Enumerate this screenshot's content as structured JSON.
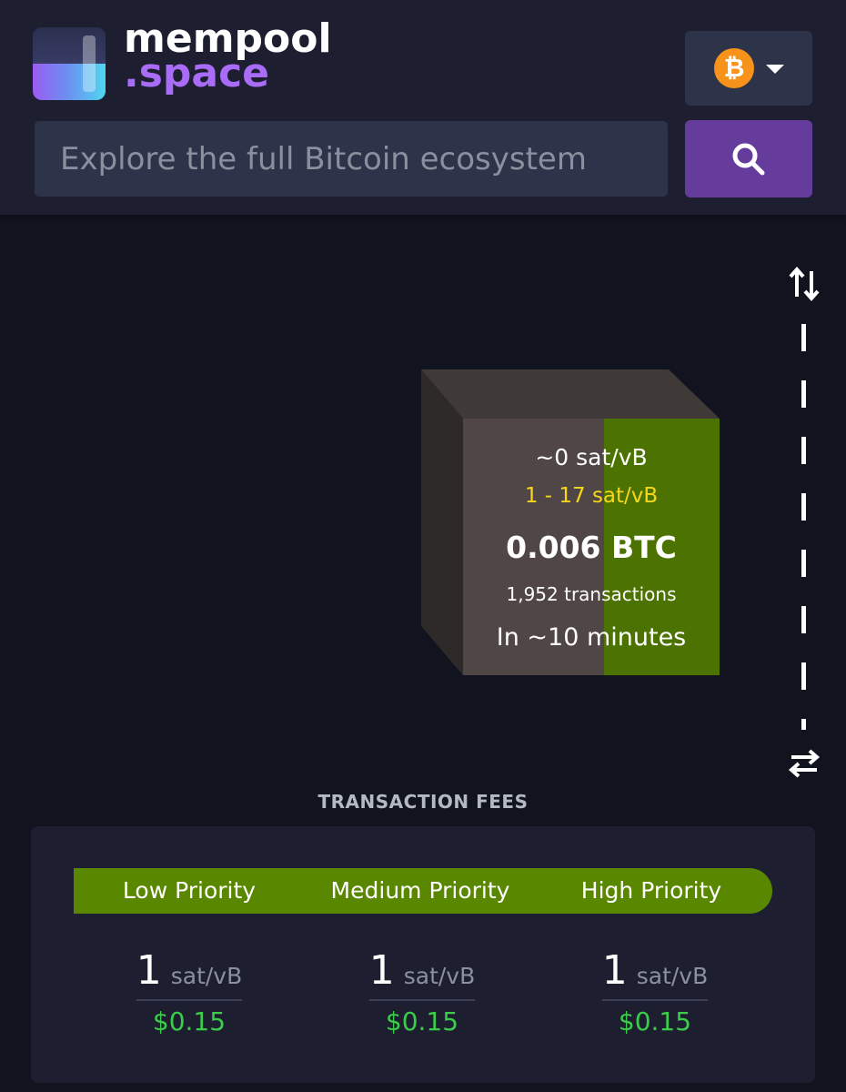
{
  "header": {
    "logo": {
      "line1": "mempool",
      "line2": ".space"
    },
    "network": {
      "icon": "bitcoin-icon",
      "symbol": "₿",
      "caret": "chevron-down-icon"
    },
    "search": {
      "placeholder": "Explore the full Bitcoin ecosystem",
      "value": "",
      "button_icon": "search-icon"
    }
  },
  "mempool_block": {
    "median_fee": "~0 sat/vB",
    "fee_range": "1 - 17 sat/vB",
    "total": "0.006 BTC",
    "transactions": "1,952 transactions",
    "eta": "In ~10 minutes",
    "fill_fraction": 0.45
  },
  "controls": {
    "toggle_layout_icon": "arrows-up-down-icon",
    "swap_icon": "arrows-left-right-icon"
  },
  "fees": {
    "title": "TRANSACTION FEES",
    "columns": [
      {
        "label": "Low Priority",
        "rate": "1",
        "unit": "sat/vB",
        "usd": "$0.15"
      },
      {
        "label": "Medium Priority",
        "rate": "1",
        "unit": "sat/vB",
        "usd": "$0.15"
      },
      {
        "label": "High Priority",
        "rate": "1",
        "unit": "sat/vB",
        "usd": "$0.15"
      }
    ]
  },
  "colors": {
    "background": "#11131f",
    "panel": "#1d1f31",
    "accent_purple": "#653b9c",
    "fee_green": "#5a8700",
    "usd_green": "#3bcc49",
    "range_yellow": "#f6d719",
    "bitcoin_orange": "#f7931a"
  }
}
